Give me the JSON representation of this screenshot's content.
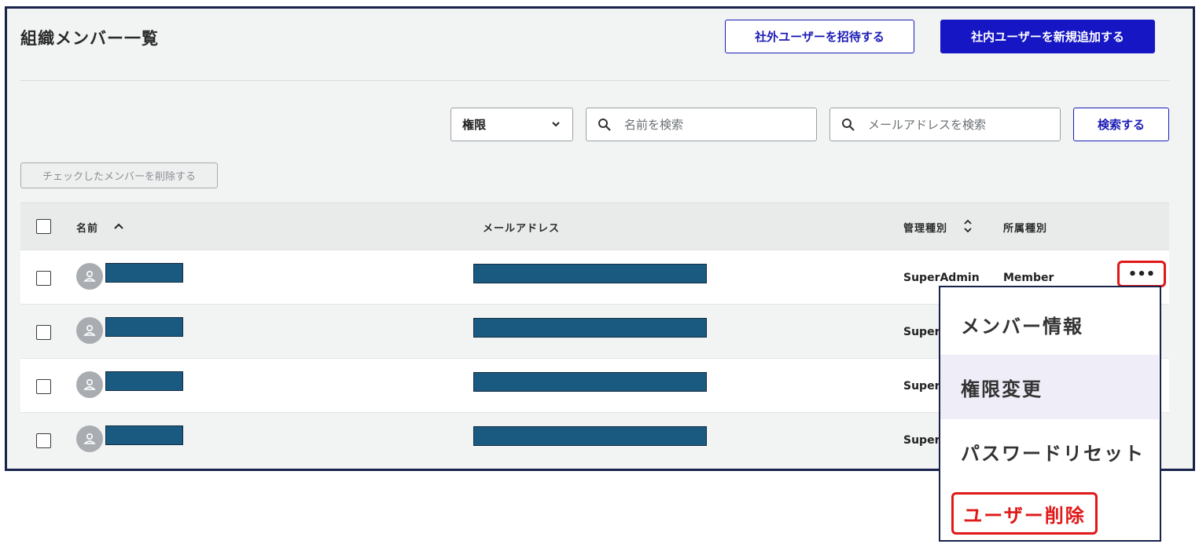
{
  "header": {
    "title": "組織メンバー一覧",
    "invite_label": "社外ユーザーを招待する",
    "add_label": "社内ユーザーを新規追加する"
  },
  "filters": {
    "role_select_value": "権限",
    "name_search_placeholder": "名前を検索",
    "email_search_placeholder": "メールアドレスを検索",
    "search_button_label": "検索する",
    "delete_checked_label": "チェックしたメンバーを削除する"
  },
  "table": {
    "columns": {
      "name": "名前",
      "email": "メールアドレス",
      "admin_type": "管理種別",
      "affiliation": "所属種別"
    },
    "rows": [
      {
        "admin_type": "SuperAdmin",
        "affiliation": "Member"
      },
      {
        "admin_type": "SuperA",
        "affiliation": ""
      },
      {
        "admin_type": "SuperA",
        "affiliation": ""
      },
      {
        "admin_type": "SuperA",
        "affiliation": ""
      }
    ],
    "more_label": "•••"
  },
  "context_menu": {
    "items": [
      {
        "label": "メンバー情報"
      },
      {
        "label": "権限変更"
      },
      {
        "label": "パスワードリセット"
      },
      {
        "label": "ユーザー削除"
      }
    ]
  },
  "colors": {
    "accent": "#1616c4",
    "danger": "#e01818",
    "frame": "#18224a",
    "redaction": "#1a5a80"
  },
  "icons": {
    "sort_name": "chevron-up-icon",
    "sort_admin": "sort-updown-icon",
    "avatar": "user-icon",
    "search": "search-icon",
    "select": "chevron-down-icon"
  }
}
